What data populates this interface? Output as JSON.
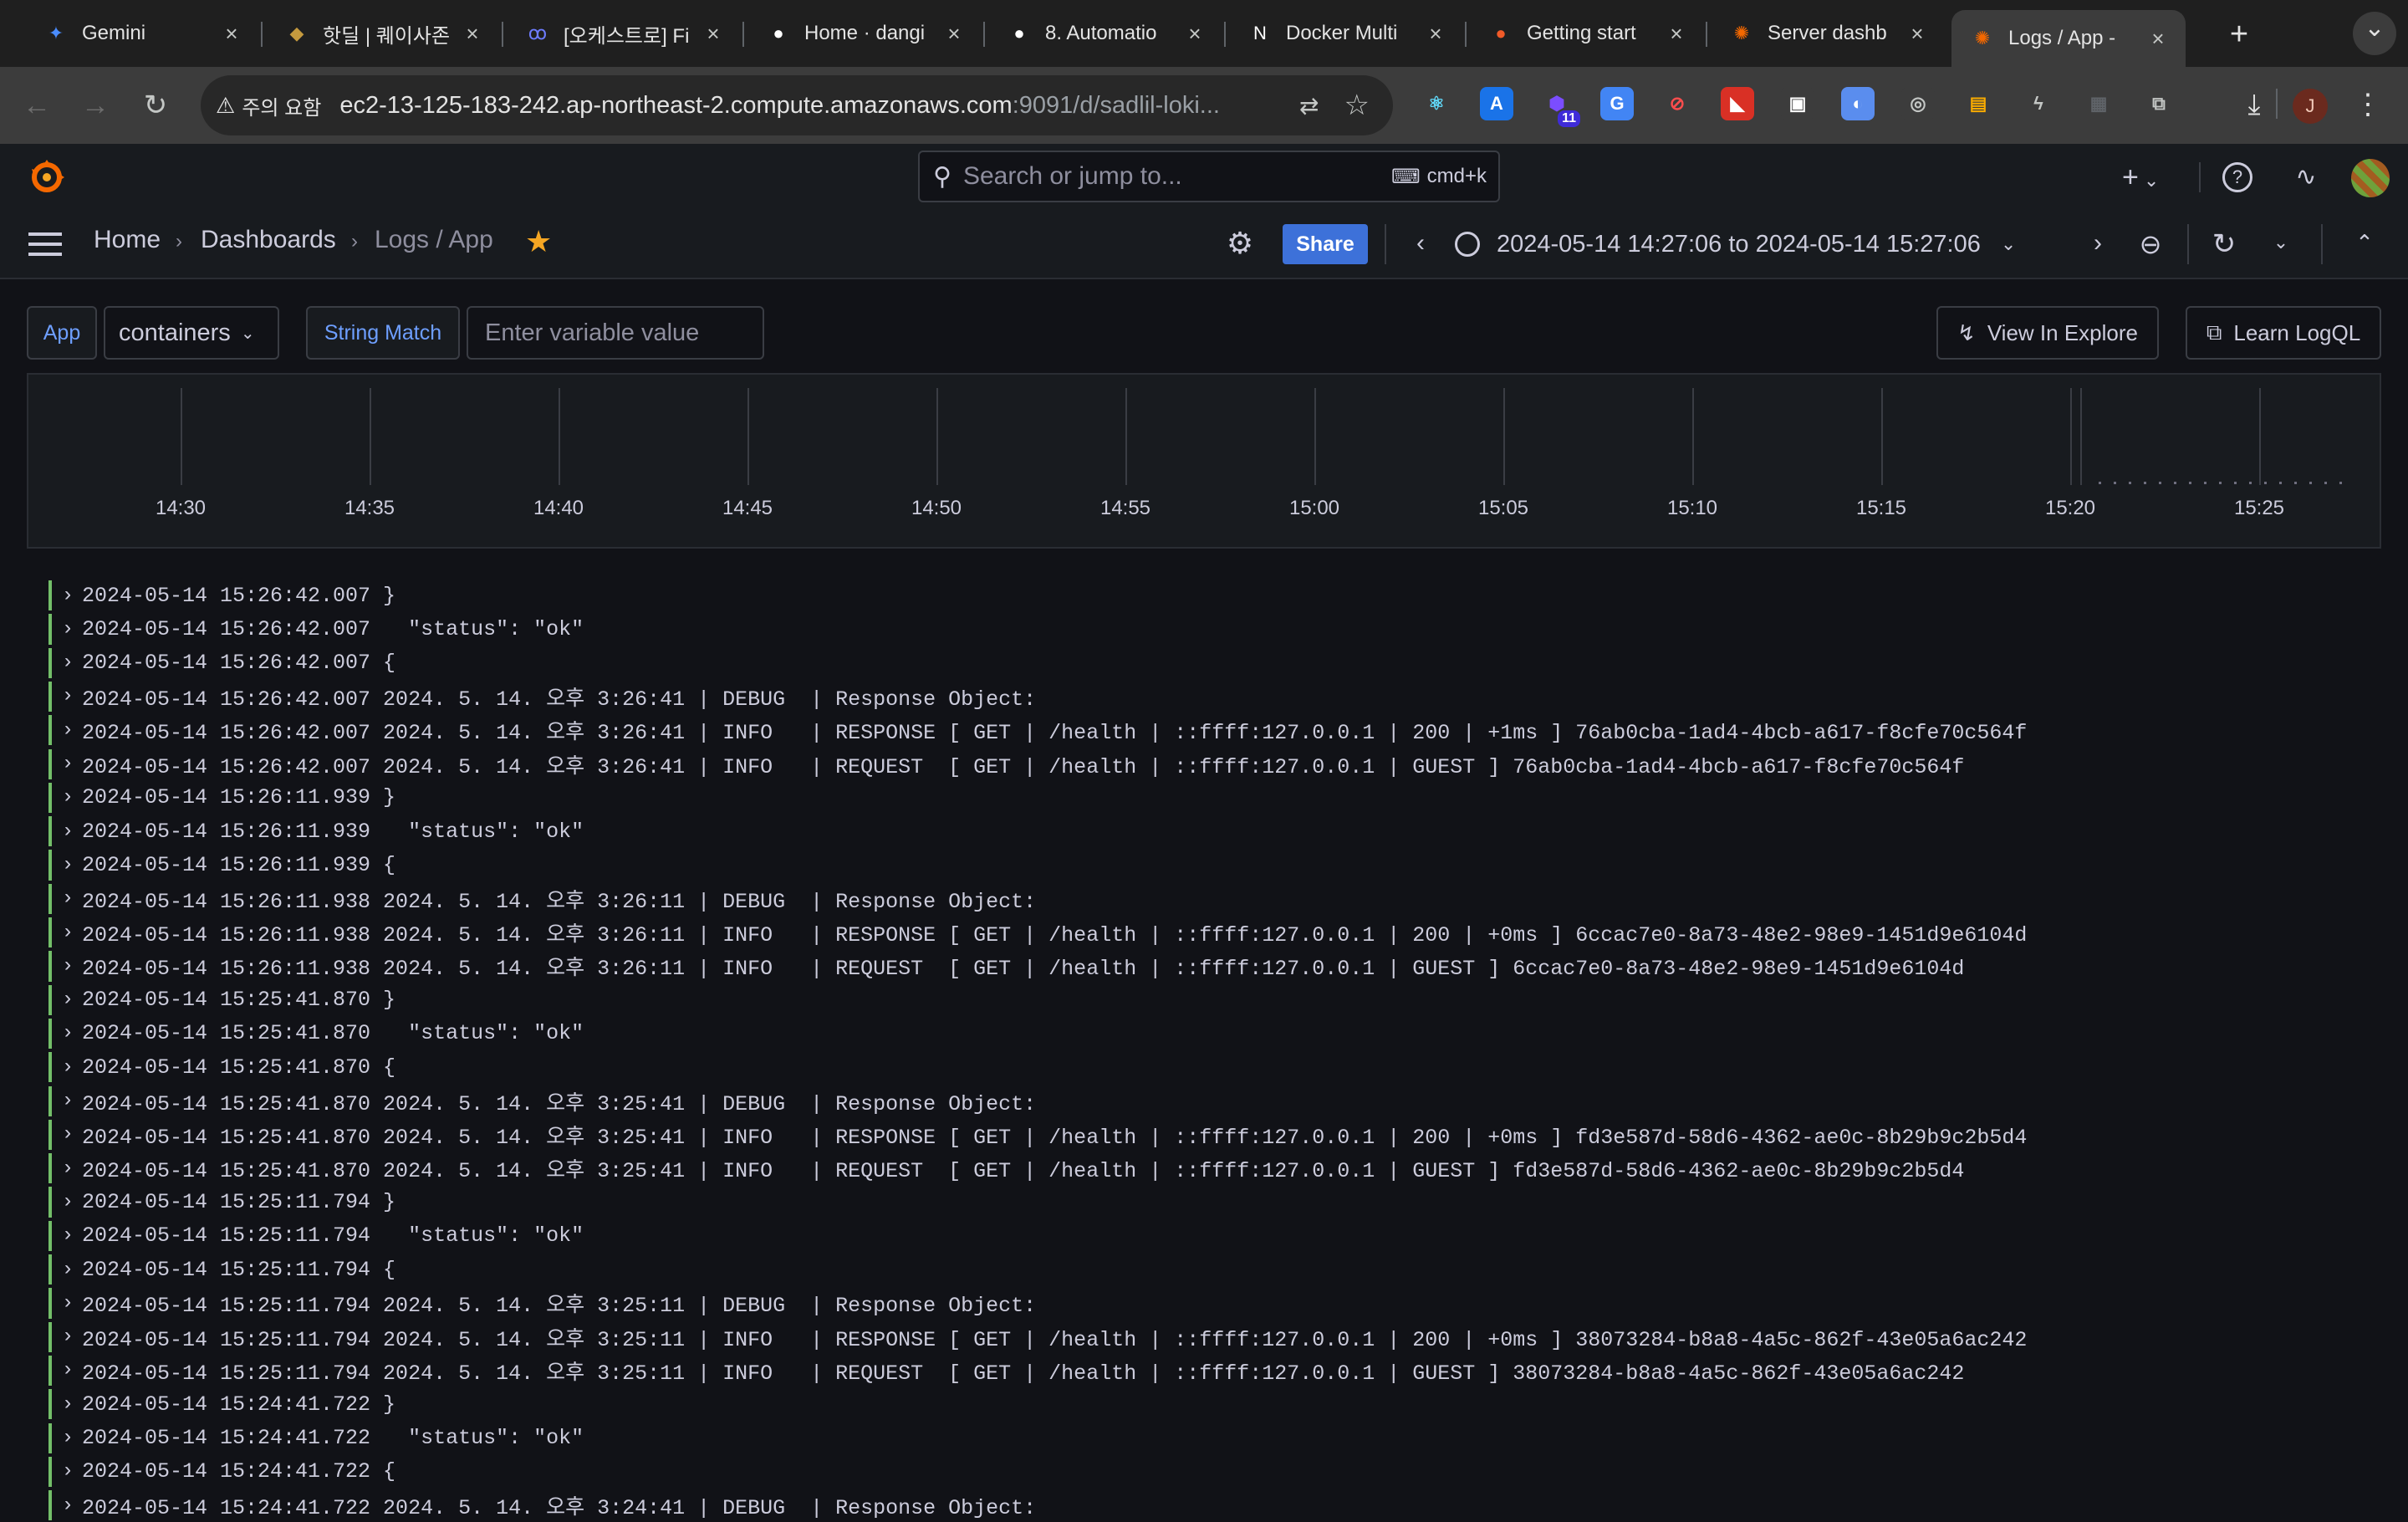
{
  "browser": {
    "tabs": [
      {
        "title": "Gemini",
        "icon": "gemini-icon",
        "color": "#4a8cff",
        "glyph": "✦"
      },
      {
        "title": "핫딜 | 퀘이사존",
        "icon": "quasarzone-icon",
        "color": "#c59a3e",
        "glyph": "◆"
      },
      {
        "title": "[오케스트로] Fi",
        "icon": "okestro-icon",
        "color": "#6d7cff",
        "glyph": "ꝏ"
      },
      {
        "title": "Home · dangi",
        "icon": "github-icon",
        "color": "#ffffff",
        "glyph": "●"
      },
      {
        "title": "8. Automatio",
        "icon": "github-icon",
        "color": "#ffffff",
        "glyph": "●"
      },
      {
        "title": "Docker Multi",
        "icon": "notion-icon",
        "color": "#ffffff",
        "glyph": "N"
      },
      {
        "title": "Getting start",
        "icon": "loki-icon",
        "color": "#f05a28",
        "glyph": "●"
      },
      {
        "title": "Server dashb",
        "icon": "grafana-icon",
        "color": "#f46800",
        "glyph": "✺"
      },
      {
        "title": "Logs / App -",
        "icon": "grafana-icon",
        "color": "#f46800",
        "glyph": "✺",
        "active": true
      }
    ],
    "new_tab": "+",
    "tab_menu": "⌄",
    "security_label": "주의 요함",
    "url_host": "ec2-13-125-183-242.ap-northeast-2.compute.amazonaws.com",
    "url_path": ":9091/d/sadlil-loki...",
    "extensions": [
      {
        "name": "react-devtools-icon",
        "glyph": "⚛",
        "color": "#61dafb",
        "bg": "#3c3c3c"
      },
      {
        "name": "a-extension-icon",
        "glyph": "A",
        "color": "#ffffff",
        "bg": "#1a73e8"
      },
      {
        "name": "hexagon-extension-icon",
        "glyph": "⬢",
        "color": "#7b4dff",
        "bg": "#3c3c3c",
        "badge": "11"
      },
      {
        "name": "translate-extension-icon",
        "glyph": "G",
        "color": "#ffffff",
        "bg": "#4285f4"
      },
      {
        "name": "block-extension-icon",
        "glyph": "⊘",
        "color": "#ff4d4d",
        "bg": "#3c3c3c"
      },
      {
        "name": "red-extension-icon",
        "glyph": "◣",
        "color": "#ffffff",
        "bg": "#d93025"
      },
      {
        "name": "window-extension-icon",
        "glyph": "▣",
        "color": "#ffffff",
        "bg": "#3c3c3c"
      },
      {
        "name": "blue-circle-extension-icon",
        "glyph": "◐",
        "color": "#ffffff",
        "bg": "#5a8dee"
      },
      {
        "name": "camera-extension-icon",
        "glyph": "◎",
        "color": "#c4c7c5",
        "bg": "#3c3c3c"
      },
      {
        "name": "color-extension-icon",
        "glyph": "▤",
        "color": "#f9ab00",
        "bg": "#3c3c3c"
      },
      {
        "name": "bolt-extension-icon",
        "glyph": "ϟ",
        "color": "#c4c7c5",
        "bg": "#3c3c3c"
      },
      {
        "name": "gray-extension-icon",
        "glyph": "▦",
        "color": "#5f6368",
        "bg": "#3c3c3c"
      },
      {
        "name": "puzzle-extension-icon",
        "glyph": "⧉",
        "color": "#c4c7c5",
        "bg": "#3c3c3c"
      }
    ],
    "profile_initial": "J"
  },
  "grafana": {
    "search_placeholder": "Search or jump to...",
    "search_shortcut": "cmd+k",
    "breadcrumb": [
      "Home",
      "Dashboards",
      "Logs / App"
    ],
    "share_label": "Share",
    "time_range": "2024-05-14 14:27:06 to 2024-05-14 15:27:06",
    "variables": {
      "app_label": "App",
      "app_value": "containers",
      "string_match_label": "String Match",
      "string_match_placeholder": "Enter variable value"
    },
    "view_in_explore": "View In Explore",
    "learn_logql": "Learn LogQL",
    "timeline_ticks": [
      "14:30",
      "14:35",
      "14:40",
      "14:45",
      "14:50",
      "14:55",
      "15:00",
      "15:05",
      "15:10",
      "15:15",
      "15:20",
      "15:25"
    ],
    "log_color": "#73bf69"
  },
  "logs": [
    "2024-05-14 15:26:42.007 }",
    "2024-05-14 15:26:42.007   \"status\": \"ok\"",
    "2024-05-14 15:26:42.007 {",
    "2024-05-14 15:26:42.007 2024. 5. 14. 오후 3:26:41 | DEBUG  | Response Object:",
    "2024-05-14 15:26:42.007 2024. 5. 14. 오후 3:26:41 | INFO   | RESPONSE [ GET | /health | ::ffff:127.0.0.1 | 200 | +1ms ] 76ab0cba-1ad4-4bcb-a617-f8cfe70c564f",
    "2024-05-14 15:26:42.007 2024. 5. 14. 오후 3:26:41 | INFO   | REQUEST  [ GET | /health | ::ffff:127.0.0.1 | GUEST ] 76ab0cba-1ad4-4bcb-a617-f8cfe70c564f",
    "2024-05-14 15:26:11.939 }",
    "2024-05-14 15:26:11.939   \"status\": \"ok\"",
    "2024-05-14 15:26:11.939 {",
    "2024-05-14 15:26:11.938 2024. 5. 14. 오후 3:26:11 | DEBUG  | Response Object:",
    "2024-05-14 15:26:11.938 2024. 5. 14. 오후 3:26:11 | INFO   | RESPONSE [ GET | /health | ::ffff:127.0.0.1 | 200 | +0ms ] 6ccac7e0-8a73-48e2-98e9-1451d9e6104d",
    "2024-05-14 15:26:11.938 2024. 5. 14. 오후 3:26:11 | INFO   | REQUEST  [ GET | /health | ::ffff:127.0.0.1 | GUEST ] 6ccac7e0-8a73-48e2-98e9-1451d9e6104d",
    "2024-05-14 15:25:41.870 }",
    "2024-05-14 15:25:41.870   \"status\": \"ok\"",
    "2024-05-14 15:25:41.870 {",
    "2024-05-14 15:25:41.870 2024. 5. 14. 오후 3:25:41 | DEBUG  | Response Object:",
    "2024-05-14 15:25:41.870 2024. 5. 14. 오후 3:25:41 | INFO   | RESPONSE [ GET | /health | ::ffff:127.0.0.1 | 200 | +0ms ] fd3e587d-58d6-4362-ae0c-8b29b9c2b5d4",
    "2024-05-14 15:25:41.870 2024. 5. 14. 오후 3:25:41 | INFO   | REQUEST  [ GET | /health | ::ffff:127.0.0.1 | GUEST ] fd3e587d-58d6-4362-ae0c-8b29b9c2b5d4",
    "2024-05-14 15:25:11.794 }",
    "2024-05-14 15:25:11.794   \"status\": \"ok\"",
    "2024-05-14 15:25:11.794 {",
    "2024-05-14 15:25:11.794 2024. 5. 14. 오후 3:25:11 | DEBUG  | Response Object:",
    "2024-05-14 15:25:11.794 2024. 5. 14. 오후 3:25:11 | INFO   | RESPONSE [ GET | /health | ::ffff:127.0.0.1 | 200 | +0ms ] 38073284-b8a8-4a5c-862f-43e05a6ac242",
    "2024-05-14 15:25:11.794 2024. 5. 14. 오후 3:25:11 | INFO   | REQUEST  [ GET | /health | ::ffff:127.0.0.1 | GUEST ] 38073284-b8a8-4a5c-862f-43e05a6ac242",
    "2024-05-14 15:24:41.722 }",
    "2024-05-14 15:24:41.722   \"status\": \"ok\"",
    "2024-05-14 15:24:41.722 {",
    "2024-05-14 15:24:41.722 2024. 5. 14. 오후 3:24:41 | DEBUG  | Response Object:"
  ]
}
